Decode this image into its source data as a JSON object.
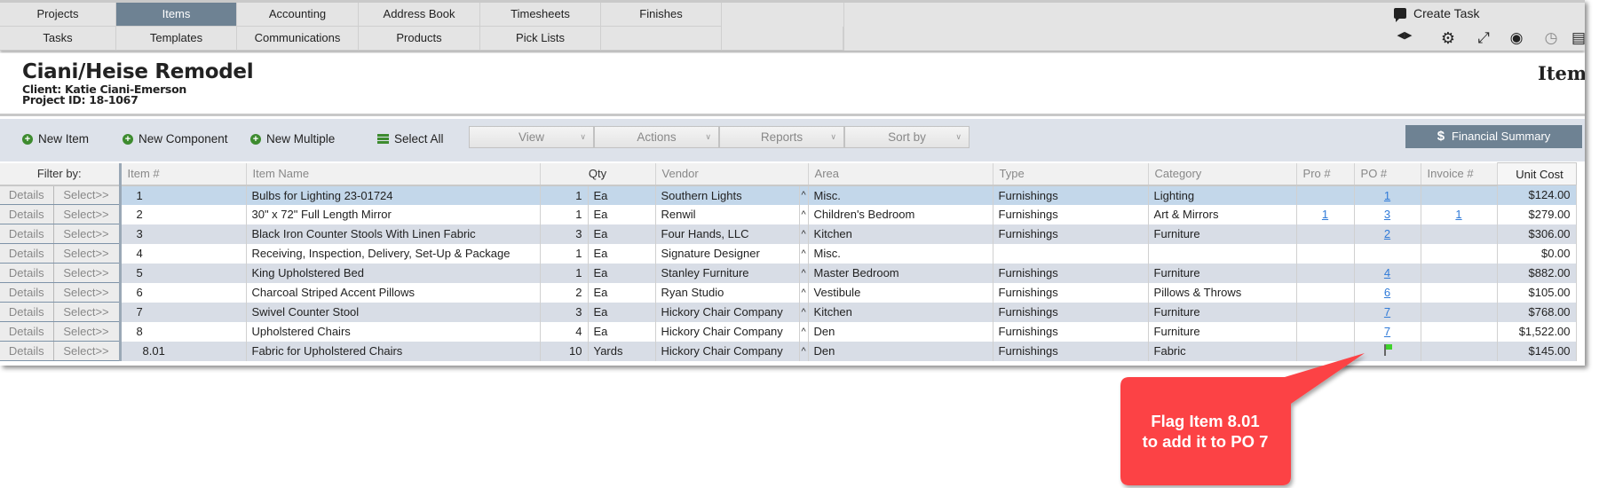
{
  "nav": {
    "row1": [
      "Projects",
      "Items",
      "Accounting",
      "Address Book",
      "Timesheets",
      "Finishes"
    ],
    "row2": [
      "Tasks",
      "Templates",
      "Communications",
      "Products",
      "Pick Lists"
    ],
    "active": "Items",
    "create_task": "Create Task"
  },
  "header": {
    "title": "Ciani/Heise Remodel",
    "client": "Client: Katie Ciani-Emerson",
    "project_id": "Project ID: 18-1067",
    "page_label": "Item"
  },
  "toolbar": {
    "new_item": "New Item",
    "new_component": "New Component",
    "new_multiple": "New Multiple",
    "select_all": "Select All",
    "dropdowns": [
      "View",
      "Actions",
      "Reports",
      "Sort by"
    ],
    "financial_summary": "Financial Summary",
    "financial_icon": "$"
  },
  "table": {
    "headers": {
      "filter": "Filter by:",
      "item_no": "Item #",
      "item_name": "Item Name",
      "qty": "Qty",
      "vendor": "Vendor",
      "area": "Area",
      "type": "Type",
      "category": "Category",
      "pro": "Pro #",
      "po": "PO #",
      "invoice": "Invoice #",
      "unit_cost": "Unit Cost"
    },
    "details_label": "Details",
    "select_label": "Select>>",
    "caret": "^",
    "rows": [
      {
        "item": "1",
        "name": "Bulbs for Lighting 23-01724",
        "qty": "1",
        "unit": "Ea",
        "vendor": "Southern Lights",
        "area": "Misc.",
        "type": "Furnishings",
        "category": "Lighting",
        "pro": "",
        "po": "1",
        "invoice": "",
        "cost": "$124.00",
        "selected": true
      },
      {
        "item": "2",
        "name": "30\" x 72\" Full Length Mirror",
        "qty": "1",
        "unit": "Ea",
        "vendor": "Renwil",
        "area": "Children's Bedroom",
        "type": "Furnishings",
        "category": "Art & Mirrors",
        "pro": "1",
        "po": "3",
        "invoice": "1",
        "cost": "$279.00"
      },
      {
        "item": "3",
        "name": "Black Iron Counter Stools With Linen Fabric",
        "qty": "3",
        "unit": "Ea",
        "vendor": "Four Hands, LLC",
        "area": "Kitchen",
        "type": "Furnishings",
        "category": "Furniture",
        "pro": "",
        "po": "2",
        "invoice": "",
        "cost": "$306.00"
      },
      {
        "item": "4",
        "name": "Receiving, Inspection, Delivery, Set-Up & Package",
        "qty": "1",
        "unit": "Ea",
        "vendor": "Signature Designer",
        "area": "Misc.",
        "type": "",
        "category": "",
        "pro": "",
        "po": "",
        "invoice": "",
        "cost": "$0.00"
      },
      {
        "item": "5",
        "name": "King Upholstered Bed",
        "qty": "1",
        "unit": "Ea",
        "vendor": "Stanley Furniture",
        "area": "Master Bedroom",
        "type": "Furnishings",
        "category": "Furniture",
        "pro": "",
        "po": "4",
        "invoice": "",
        "cost": "$882.00"
      },
      {
        "item": "6",
        "name": "Charcoal Striped Accent Pillows",
        "qty": "2",
        "unit": "Ea",
        "vendor": "Ryan Studio",
        "area": "Vestibule",
        "type": "Furnishings",
        "category": "Pillows & Throws",
        "pro": "",
        "po": "6",
        "invoice": "",
        "cost": "$105.00"
      },
      {
        "item": "7",
        "name": "Swivel Counter Stool",
        "qty": "3",
        "unit": "Ea",
        "vendor": "Hickory Chair Company",
        "area": "Kitchen",
        "type": "Furnishings",
        "category": "Furniture",
        "pro": "",
        "po": "7",
        "invoice": "",
        "cost": "$768.00"
      },
      {
        "item": "8",
        "name": "Upholstered Chairs",
        "qty": "4",
        "unit": "Ea",
        "vendor": "Hickory Chair Company",
        "area": "Den",
        "type": "Furnishings",
        "category": "Furniture",
        "pro": "",
        "po": "7",
        "invoice": "",
        "cost": "$1,522.00"
      },
      {
        "item": "8.01",
        "name": "Fabric for Upholstered Chairs",
        "qty": "10",
        "unit": "Yards",
        "vendor": "Hickory Chair Company",
        "area": "Den",
        "type": "Furnishings",
        "category": "Fabric",
        "pro": "",
        "po": "",
        "po_flag": "green-flag-icon",
        "invoice": "",
        "cost": "$145.00",
        "component": true
      }
    ]
  },
  "callout": {
    "line1": "Flag Item 8.01",
    "line2": "to add it to PO 7",
    "color": "#fc4245"
  },
  "colors": {
    "accent": "#6e8293",
    "link": "#2f7ad8",
    "flag": "#3fd12c",
    "selected_row": "#c3d7ea"
  }
}
